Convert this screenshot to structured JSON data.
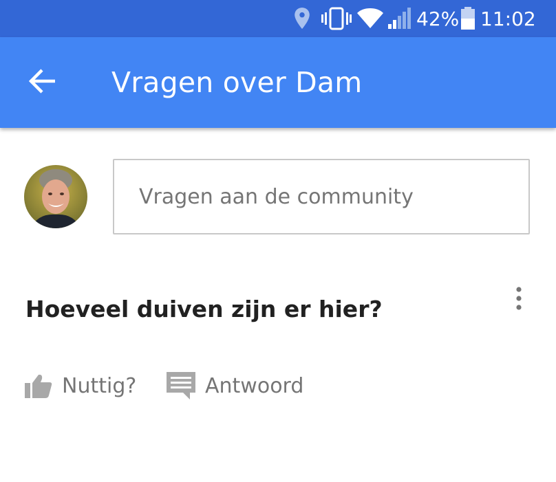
{
  "status_bar": {
    "battery_percent": "42%",
    "time": "11:02",
    "icons": [
      "location-icon",
      "vibrate-icon",
      "wifi-icon",
      "signal-icon",
      "battery-icon"
    ]
  },
  "app_bar": {
    "title": "Vragen over Dam",
    "back_icon": "arrow-back-icon"
  },
  "ask": {
    "placeholder": "Vragen aan de community"
  },
  "question": {
    "text": "Hoeveel duiven zijn er hier?",
    "actions": {
      "helpful_label": "Nuttig?",
      "answer_label": "Antwoord"
    }
  },
  "colors": {
    "status_bar": "#3367d6",
    "app_bar": "#4285f4",
    "icon_grey": "#a8a8a8",
    "text_primary": "#212121",
    "text_secondary": "#757575"
  }
}
